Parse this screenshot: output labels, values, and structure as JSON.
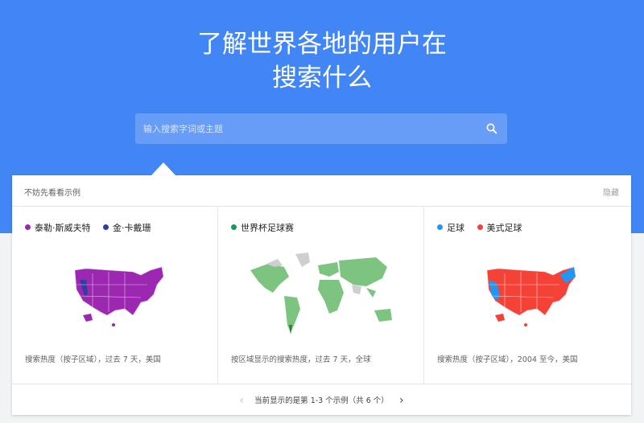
{
  "hero": {
    "title_line1": "了解世界各地的用户在",
    "title_line2": "搜索什么",
    "search_placeholder": "输入搜索字词或主题",
    "search_icon": "search-icon"
  },
  "panel": {
    "title": "不妨先看看示例",
    "hide_label": "隐藏"
  },
  "cards": [
    {
      "legend": [
        {
          "label": "泰勒·斯威夫特",
          "color": "#9c27b0"
        },
        {
          "label": "金·卡戴珊",
          "color": "#303f9f"
        }
      ],
      "map": "usa-map",
      "caption": "搜索热度（按子区域），过去 7 天，美国"
    },
    {
      "legend": [
        {
          "label": "世界杯足球赛",
          "color": "#0f9d58"
        }
      ],
      "map": "world-map",
      "caption": "按区域显示的搜索热度，过去 7 天，全球"
    },
    {
      "legend": [
        {
          "label": "足球",
          "color": "#2196f3"
        },
        {
          "label": "美式足球",
          "color": "#f44336"
        }
      ],
      "map": "usa-map",
      "caption": "搜索热度（按子区域），2004 至今，美国"
    }
  ],
  "pager": {
    "text": "当前显示的是第 1-3 个示例（共 6 个）",
    "prev_icon": "chevron-left-icon",
    "next_icon": "chevron-right-icon"
  },
  "colors": {
    "hero_bg": "#4285f4",
    "purple": "#9c27b0",
    "indigo": "#303f9f",
    "green": "#7cc47f",
    "red": "#f44336",
    "blue": "#2196f3"
  }
}
